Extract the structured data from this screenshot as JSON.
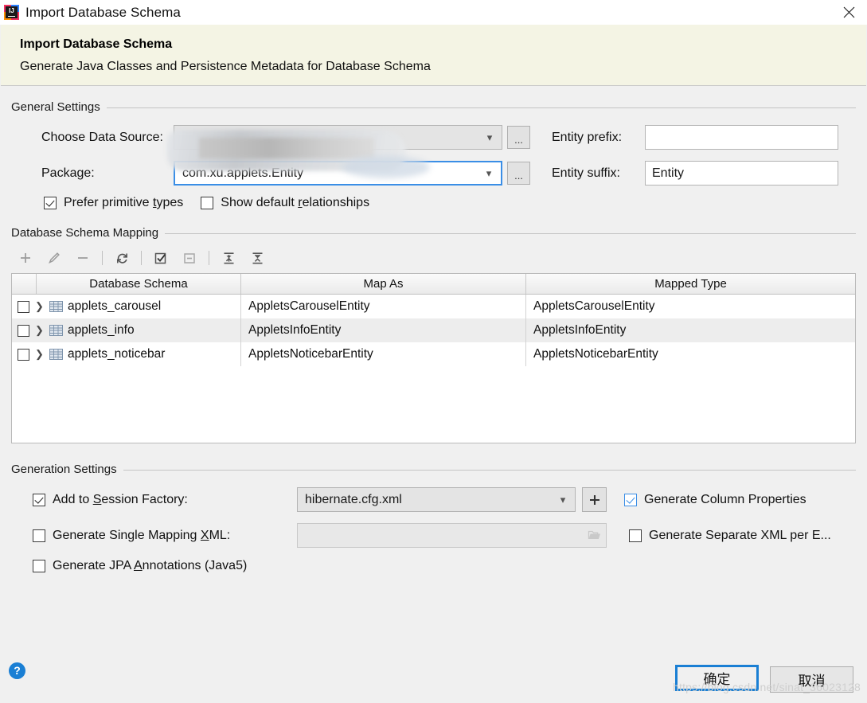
{
  "window": {
    "title": "Import Database Schema",
    "app_icon": "intellij-idea-icon",
    "close_icon": "close-icon"
  },
  "banner": {
    "title": "Import Database Schema",
    "subtitle": "Generate Java Classes and Persistence Metadata for Database Schema",
    "background_color": "#f4f4e4"
  },
  "general_settings": {
    "group_title": "General Settings",
    "data_source": {
      "label": "Choose Data Source:",
      "value": "",
      "redacted": true,
      "browse_label": "...",
      "dropdown_icon": "chevron-down-icon"
    },
    "package": {
      "label": "Package:",
      "value": "com.xu.applets.Entity",
      "browse_label": "...",
      "dropdown_icon": "chevron-down-icon",
      "focused": true
    },
    "entity_prefix": {
      "label": "Entity prefix:",
      "value": ""
    },
    "entity_suffix": {
      "label": "Entity suffix:",
      "value": "Entity"
    },
    "prefer_primitive_types": {
      "label": "Prefer primitive types",
      "mnemonic": "t",
      "checked": true
    },
    "show_default_relationships": {
      "label": "Show default relationships",
      "mnemonic": "r",
      "checked": false
    }
  },
  "schema_mapping": {
    "group_title": "Database Schema Mapping",
    "toolbar": [
      {
        "name": "add-icon",
        "glyph": "+",
        "enabled": false
      },
      {
        "name": "edit-pencil-icon",
        "glyph": "pencil",
        "enabled": false
      },
      {
        "name": "remove-icon",
        "glyph": "−",
        "enabled": false
      },
      {
        "name": "refresh-icon",
        "glyph": "refresh",
        "enabled": true
      },
      {
        "name": "select-all-icon",
        "glyph": "checkbox-checked",
        "enabled": true
      },
      {
        "name": "deselect-all-icon",
        "glyph": "checkbox-minus",
        "enabled": false
      },
      {
        "name": "expand-all-icon",
        "glyph": "expand-all",
        "enabled": true
      },
      {
        "name": "collapse-all-icon",
        "glyph": "collapse-all",
        "enabled": true
      }
    ],
    "columns": [
      "Database Schema",
      "Map As",
      "Mapped Type"
    ],
    "rows": [
      {
        "checked": false,
        "schema": "applets_carousel",
        "map_as": "AppletsCarouselEntity",
        "mapped_type": "AppletsCarouselEntity"
      },
      {
        "checked": false,
        "schema": "applets_info",
        "map_as": "AppletsInfoEntity",
        "mapped_type": "AppletsInfoEntity"
      },
      {
        "checked": false,
        "schema": "applets_noticebar",
        "map_as": "AppletsNoticebarEntity",
        "mapped_type": "AppletsNoticebarEntity"
      }
    ]
  },
  "generation_settings": {
    "group_title": "Generation Settings",
    "add_to_session_factory": {
      "label": "Add to Session Factory:",
      "mnemonic": "S",
      "checked": true
    },
    "session_factory_file": {
      "value": "hibernate.cfg.xml",
      "dropdown_icon": "chevron-down-icon"
    },
    "add_config_button": {
      "label": "+",
      "icon": "plus-icon"
    },
    "generate_single_mapping_xml": {
      "label": "Generate Single Mapping XML:",
      "mnemonic": "X",
      "checked": false
    },
    "single_mapping_path": {
      "value": "",
      "icon": "folder-icon",
      "disabled": true
    },
    "generate_jpa_annotations": {
      "label": "Generate JPA Annotations (Java5)",
      "mnemonic": "A",
      "checked": false
    },
    "generate_column_properties": {
      "label": "Generate Column Properties",
      "checked": true,
      "accent_color": "#3a8ee6"
    },
    "generate_separate_xml": {
      "label": "Generate Separate XML per E...",
      "checked": false
    }
  },
  "footer": {
    "help_icon": "help-icon",
    "help_glyph": "?",
    "ok_button": "确定",
    "cancel_button": "取消",
    "watermark": "https://blog.csdn.net/sinat_36023128"
  }
}
